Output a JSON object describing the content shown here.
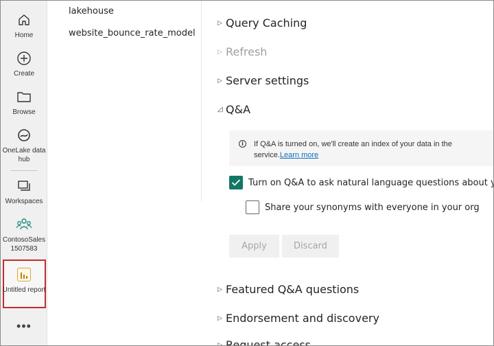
{
  "rail": {
    "items": [
      {
        "label": "Home",
        "icon": "home-icon"
      },
      {
        "label": "Create",
        "icon": "create-icon"
      },
      {
        "label": "Browse",
        "icon": "browse-icon"
      },
      {
        "label": "OneLake data hub",
        "icon": "onelake-icon"
      },
      {
        "label": "Workspaces",
        "icon": "workspaces-icon"
      },
      {
        "label": "ContosoSales1507583",
        "icon": "workspace-people-icon"
      },
      {
        "label": "Untitled report",
        "icon": "report-icon"
      },
      {
        "label": "•••",
        "icon": "more-icon"
      }
    ]
  },
  "list": {
    "items": [
      "lakehouse",
      "website_bounce_rate_model"
    ]
  },
  "settings": {
    "query_caching": "Query Caching",
    "refresh": "Refresh",
    "server_settings": "Server settings",
    "qna": "Q&A",
    "info_text": "If Q&A is turned on, we'll create an index of your data in the service.",
    "info_link": "Learn more",
    "turn_on_label": "Turn on Q&A to ask natural language questions about your data",
    "share_synonyms_label": "Share your synonyms with everyone in your org",
    "apply": "Apply",
    "discard": "Discard",
    "featured_qna": "Featured Q&A questions",
    "endorsement": "Endorsement and discovery",
    "request_access": "Request access"
  },
  "colors": {
    "accent_check": "#117865",
    "highlight_border": "#c42b2b",
    "link": "#0f6cbd"
  }
}
